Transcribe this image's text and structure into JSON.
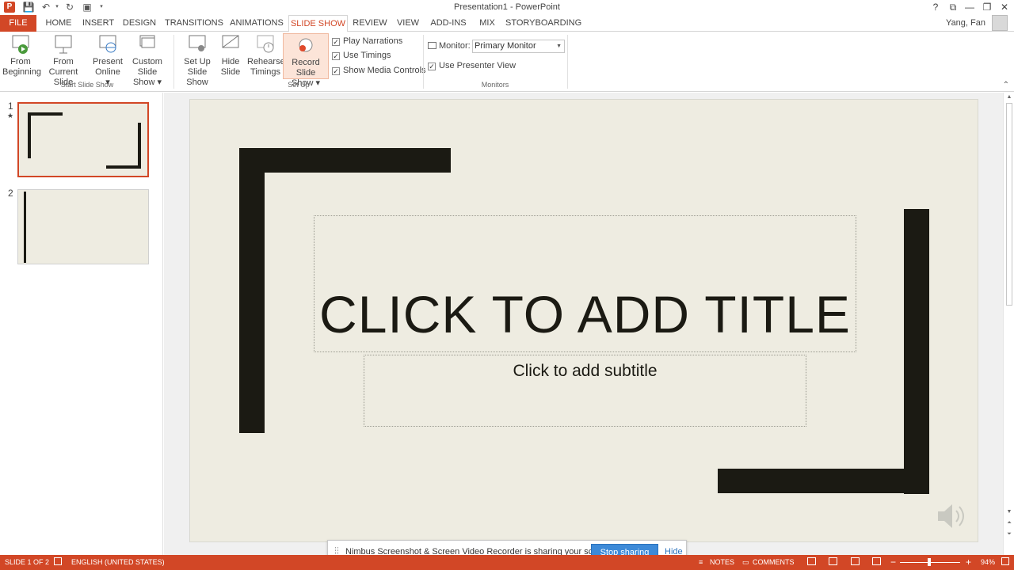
{
  "window": {
    "title": "Presentation1 - PowerPoint",
    "logo": "P",
    "controls": {
      "help": "?",
      "restore_ribbon": "⧉",
      "minimize": "—",
      "maximize": "❐",
      "close": "✕"
    }
  },
  "quick_access": {
    "icons": [
      "save-icon",
      "undo-icon",
      "redo-icon",
      "present-icon",
      "customize-icon"
    ]
  },
  "tabs": [
    {
      "label": "FILE"
    },
    {
      "label": "HOME"
    },
    {
      "label": "INSERT"
    },
    {
      "label": "DESIGN"
    },
    {
      "label": "TRANSITIONS"
    },
    {
      "label": "ANIMATIONS"
    },
    {
      "label": "SLIDE SHOW"
    },
    {
      "label": "REVIEW"
    },
    {
      "label": "VIEW"
    },
    {
      "label": "ADD-INS"
    },
    {
      "label": "MIX"
    },
    {
      "label": "STORYBOARDING"
    }
  ],
  "user": {
    "name": "Yang, Fan"
  },
  "ribbon": {
    "start_group": {
      "label": "Start Slide Show",
      "from_beginning": [
        "From",
        "Beginning"
      ],
      "from_current": [
        "From",
        "Current Slide"
      ],
      "present_online": [
        "Present",
        "Online ▾"
      ],
      "custom_show": [
        "Custom Slide",
        "Show ▾"
      ]
    },
    "setup_group": {
      "label": "Set Up",
      "setup_show": [
        "Set Up",
        "Slide Show"
      ],
      "hide_slide": [
        "Hide",
        "Slide"
      ],
      "rehearse": [
        "Rehearse",
        "Timings"
      ],
      "record": [
        "Record Slide",
        "Show ▾"
      ],
      "checks": [
        {
          "label": "Play Narrations",
          "checked": true
        },
        {
          "label": "Use Timings",
          "checked": true
        },
        {
          "label": "Show Media Controls",
          "checked": true
        }
      ]
    },
    "monitors_group": {
      "label": "Monitors",
      "monitor_label": "Monitor:",
      "monitor_value": "Primary Monitor",
      "presenter_view": {
        "label": "Use Presenter View",
        "checked": true
      }
    }
  },
  "thumbnails": [
    {
      "number": "1",
      "marker": "★"
    },
    {
      "number": "2"
    }
  ],
  "slide": {
    "title_placeholder": "CLICK TO ADD TITLE",
    "subtitle_placeholder": "Click to add subtitle",
    "background": "#eeece1",
    "accent": "#1b1a13"
  },
  "share_banner": {
    "message": "Nimbus Screenshot & Screen Video Recorder is sharing your screen.",
    "stop_label": "Stop sharing",
    "hide_label": "Hide"
  },
  "statusbar": {
    "slide_info": "SLIDE 1 OF 2",
    "language": "ENGLISH (UNITED STATES)",
    "notes": "NOTES",
    "comments": "COMMENTS",
    "zoom_minus": "−",
    "zoom_plus": "+",
    "zoom": "94%"
  },
  "colors": {
    "accent": "#d24726",
    "share_button": "#3d8ad8"
  }
}
